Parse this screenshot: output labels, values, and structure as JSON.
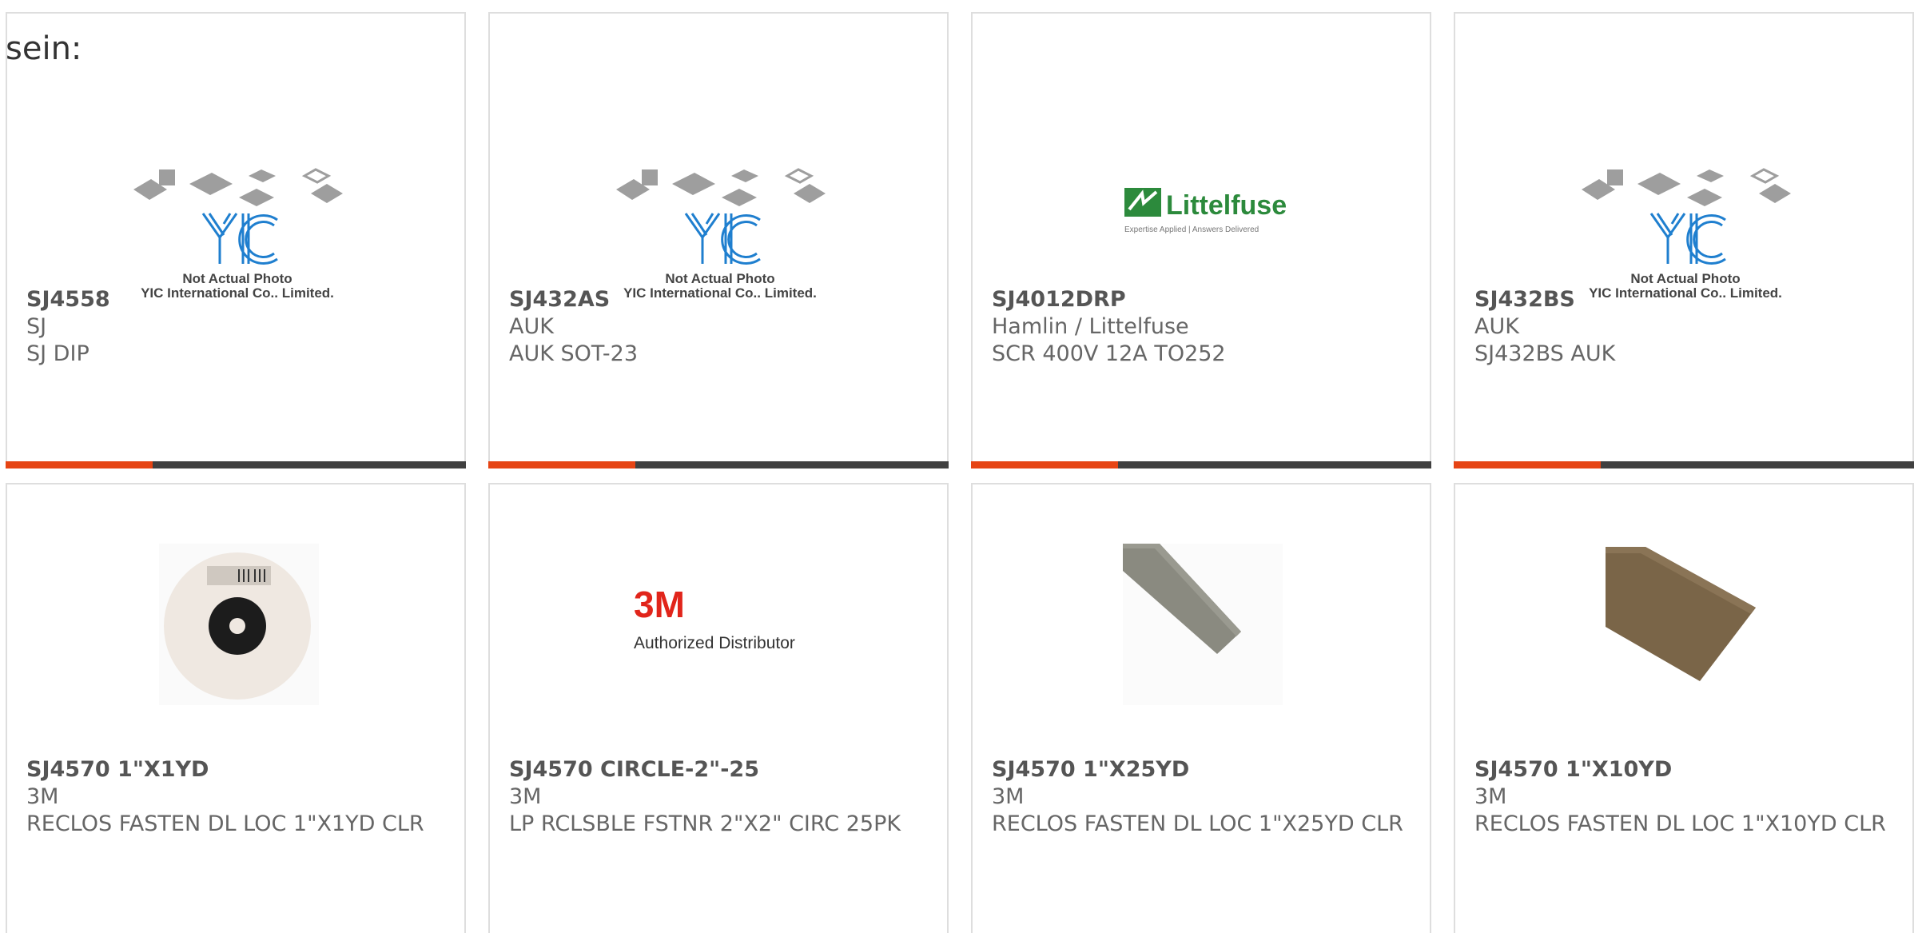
{
  "intro_text": "sein:",
  "accent_color": "#e64414",
  "bar_color": "#404040",
  "products": [
    {
      "part": "SJ4558",
      "manufacturer": "SJ",
      "description": "SJ DIP",
      "image": "yic-placeholder",
      "image_text": [
        "Not Actual Photo",
        "YIC International Co., Limited."
      ]
    },
    {
      "part": "SJ432AS",
      "manufacturer": "AUK",
      "description": "AUK SOT-23",
      "image": "yic-placeholder",
      "image_text": [
        "Not Actual Photo",
        "YIC International Co., Limited."
      ]
    },
    {
      "part": "SJ4012DRP",
      "manufacturer": "Hamlin / Littelfuse",
      "description": "SCR 400V 12A TO252",
      "image": "littelfuse-logo",
      "image_text": [
        "Littelfuse",
        "Expertise Applied | Answers Delivered"
      ]
    },
    {
      "part": "SJ432BS",
      "manufacturer": "AUK",
      "description": "SJ432BS AUK",
      "image": "yic-placeholder",
      "image_text": [
        "Not Actual Photo",
        "YIC International Co., Limited."
      ]
    },
    {
      "part": "SJ4570 1\"X1YD",
      "manufacturer": "3M",
      "description": "RECLOS FASTEN DL LOC 1\"X1YD CLR",
      "image": "tape-roll-photo"
    },
    {
      "part": "SJ4570 CIRCLE-2\"-25",
      "manufacturer": "3M",
      "description": "LP RCLSBLE FSTNR 2\"X2\" CIRC 25PK",
      "image": "3m-logo",
      "image_text": [
        "3M",
        "Authorized Distributor"
      ]
    },
    {
      "part": "SJ4570 1\"X25YD",
      "manufacturer": "3M",
      "description": "RECLOS FASTEN DL LOC 1\"X25YD CLR",
      "image": "grey-strip-photo"
    },
    {
      "part": "SJ4570 1\"X10YD",
      "manufacturer": "3M",
      "description": "RECLOS FASTEN DL LOC 1\"X10YD CLR",
      "image": "brown-strip-photo"
    }
  ]
}
